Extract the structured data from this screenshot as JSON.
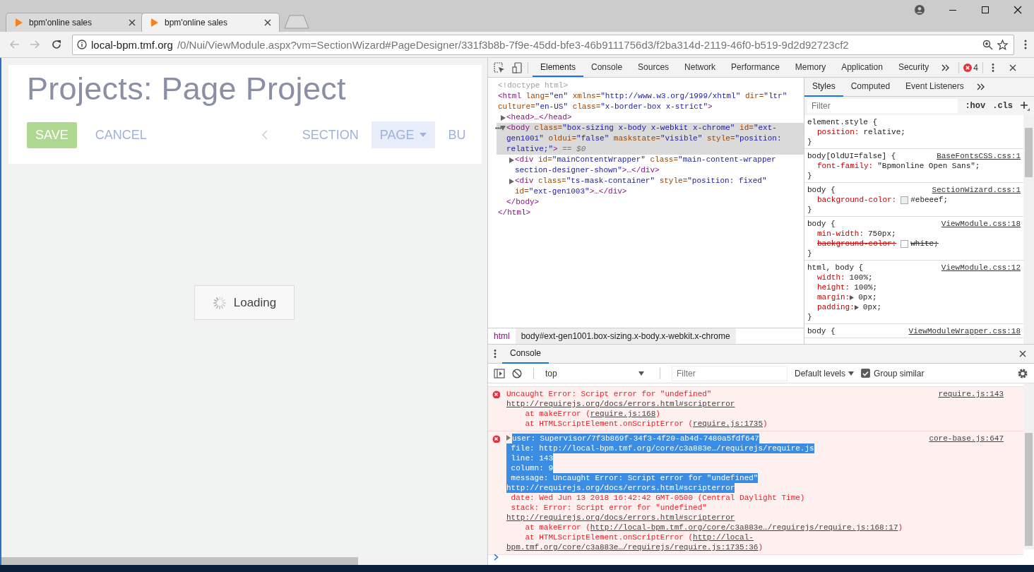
{
  "browser": {
    "tabs": [
      {
        "title": "bpm'online sales",
        "selected": false
      },
      {
        "title": "bpm'online sales",
        "selected": true
      }
    ],
    "address": {
      "host": "local-bpm.tmf.org",
      "path": "/0/Nui/ViewModule.aspx?vm=SectionWizard#PageDesigner/331f3b8b-7f9e-45dd-bfe3-46b9111756d3/f2ba314d-2119-46f0-b519-9d2d92723cf2"
    }
  },
  "page": {
    "title": "Projects: Page Project",
    "actions": [
      {
        "label": "SAVE",
        "kind": "primary"
      },
      {
        "label": "CANCEL",
        "kind": "link"
      }
    ],
    "nav": [
      {
        "label": "SECTION",
        "selected": false,
        "dropdown": false
      },
      {
        "label": "PAGE",
        "selected": true,
        "dropdown": true
      },
      {
        "label": "BU",
        "selected": false,
        "dropdown": false
      }
    ],
    "loading": "Loading"
  },
  "devtools": {
    "tabs": [
      {
        "label": "Elements",
        "selected": true
      },
      {
        "label": "Console",
        "selected": false
      },
      {
        "label": "Sources",
        "selected": false
      },
      {
        "label": "Network",
        "selected": false
      },
      {
        "label": "Performance",
        "selected": false
      },
      {
        "label": "Memory",
        "selected": false
      },
      {
        "label": "Application",
        "selected": false
      },
      {
        "label": "Security",
        "selected": false
      }
    ],
    "error_count": "4",
    "elements": {
      "nodes": [
        {
          "tokens": [
            {
              "kind": "doctype",
              "t": "<!doctype html>"
            }
          ]
        },
        {
          "tokens": [
            {
              "kind": "tag",
              "t": "<html"
            },
            {
              "kind": "attr",
              "t": " lang="
            },
            {
              "kind": "value",
              "t": "\"en\""
            },
            {
              "kind": "attr",
              "t": " xmlns="
            },
            {
              "kind": "value",
              "t": "\"http://www.w3.org/1999/xhtml\""
            },
            {
              "kind": "attr",
              "t": " dir="
            },
            {
              "kind": "value",
              "t": "\"ltr\""
            },
            {
              "kind": "attr",
              "t": " culture="
            },
            {
              "kind": "value",
              "t": "\"en-US\""
            },
            {
              "kind": "attr",
              "t": " class="
            },
            {
              "kind": "value",
              "t": "\"x-border-box x-strict\""
            },
            {
              "kind": "tag",
              "t": ">"
            }
          ],
          "close": "</html>",
          "children": [
            {
              "tokens": [
                {
                  "kind": "tag",
                  "t": "<head>…</head>"
                }
              ],
              "expanded": false
            },
            {
              "tokens": [
                {
                  "kind": "tag",
                  "t": "<body"
                },
                {
                  "kind": "attr",
                  "t": " class="
                },
                {
                  "kind": "value",
                  "t": "\"box-sizing x-body x-webkit x-chrome\""
                },
                {
                  "kind": "attr",
                  "t": " id="
                },
                {
                  "kind": "value",
                  "t": "\"ext-gen1001\""
                },
                {
                  "kind": "attr",
                  "t": " oldui="
                },
                {
                  "kind": "value",
                  "t": "\"false\""
                },
                {
                  "kind": "attr",
                  "t": " maskstate="
                },
                {
                  "kind": "value",
                  "t": "\"visible\""
                },
                {
                  "kind": "attr",
                  "t": " style="
                },
                {
                  "kind": "value",
                  "t": "\"position: relative;\""
                },
                {
                  "kind": "tag",
                  "t": ">"
                },
                {
                  "kind": "hint",
                  "t": " == $0"
                }
              ],
              "expanded": true,
              "selected": true,
              "close": "</body>",
              "children": [
                {
                  "tokens": [
                    {
                      "kind": "tag",
                      "t": "<div"
                    },
                    {
                      "kind": "attr",
                      "t": " id="
                    },
                    {
                      "kind": "value",
                      "t": "\"mainContentWrapper\""
                    },
                    {
                      "kind": "attr",
                      "t": " class="
                    },
                    {
                      "kind": "value",
                      "t": "\"main-content-wrapper section-designer-shown\""
                    },
                    {
                      "kind": "tag",
                      "t": ">…</div>"
                    }
                  ],
                  "expanded": false
                },
                {
                  "tokens": [
                    {
                      "kind": "tag",
                      "t": "<div"
                    },
                    {
                      "kind": "attr",
                      "t": " class="
                    },
                    {
                      "kind": "value",
                      "t": "\"ts-mask-container\""
                    },
                    {
                      "kind": "attr",
                      "t": " style="
                    },
                    {
                      "kind": "value",
                      "t": "\"position: fixed\""
                    },
                    {
                      "kind": "attr",
                      "t": " id="
                    },
                    {
                      "kind": "value",
                      "t": "\"ext-gen1003\""
                    },
                    {
                      "kind": "tag",
                      "t": ">…</div>"
                    }
                  ],
                  "expanded": false
                }
              ]
            }
          ]
        }
      ],
      "breadcrumbs": [
        {
          "label": "html",
          "selected": false
        },
        {
          "label": "body#ext-gen1001.box-sizing.x-body.x-webkit.x-chrome",
          "selected": true
        }
      ]
    },
    "styles": {
      "tabs": [
        {
          "label": "Styles",
          "selected": true
        },
        {
          "label": "Computed",
          "selected": false
        },
        {
          "label": "Event Listeners",
          "selected": false
        }
      ],
      "filter_placeholder": "Filter",
      "hov": ":hov",
      "cls": ".cls",
      "rules": [
        {
          "selector": "element.style {",
          "close": "}",
          "properties": [
            {
              "name": "position:",
              "value": "relative;"
            }
          ]
        },
        {
          "selector": "body[OldUI=false] {",
          "source": "BaseFontsCSS.css:1",
          "close": "}",
          "properties": [
            {
              "name": "font-family:",
              "value": "\"Bpmonline Open Sans\";"
            }
          ]
        },
        {
          "selector": "body {",
          "source": "SectionWizard.css:1",
          "close": "}",
          "properties": [
            {
              "name": "background-color:",
              "value": "#ebeeef;",
              "color": "#ebeeef"
            }
          ]
        },
        {
          "selector": "body {",
          "source": "ViewModule.css:18",
          "close": "}",
          "properties": [
            {
              "name": "min-width:",
              "value": "750px;"
            },
            {
              "name": "background-color:",
              "value": "white;",
              "color": "#ffffff",
              "struck": true
            }
          ]
        },
        {
          "selector": "html, body {",
          "source": "ViewModule.css:12",
          "close": "}",
          "properties": [
            {
              "name": "width:",
              "value": "100%;"
            },
            {
              "name": "height:",
              "value": "100%;"
            },
            {
              "name": "margin:",
              "value": "0px;",
              "expandable": true
            },
            {
              "name": "padding:",
              "value": "0px;",
              "expandable": true
            }
          ]
        },
        {
          "selector": "body {",
          "source": "ViewModuleWrapper.css:18"
        }
      ]
    },
    "console": {
      "tabs": [
        {
          "label": "Console",
          "selected": true
        }
      ],
      "context": "top",
      "filter_placeholder": "Filter",
      "levels": "Default levels",
      "group_similar": {
        "label": "Group similar",
        "checked": true
      },
      "messages": [
        {
          "kind": "error",
          "source": "require.js:143",
          "expandable": false,
          "lines": [
            {
              "selected": false,
              "parts": [
                {
                  "t": "Uncaught Error: Script error for \"undefined\""
                }
              ]
            },
            {
              "selected": false,
              "parts": [
                {
                  "t": "http://requirejs.org/docs/errors.html#scripterror",
                  "link": true
                }
              ]
            },
            {
              "selected": false,
              "parts": [
                {
                  "t": "    at makeError ("
                },
                {
                  "t": "require.js:168",
                  "link": true
                },
                {
                  "t": ")"
                }
              ]
            },
            {
              "selected": false,
              "parts": [
                {
                  "t": "    at HTMLScriptElement.onScriptError ("
                },
                {
                  "t": "require.js:1735",
                  "link": true
                },
                {
                  "t": ")"
                }
              ]
            }
          ]
        },
        {
          "kind": "error",
          "source": "core-base.js:647",
          "expandable": true,
          "lines": [
            {
              "selected": true,
              "parts": [
                {
                  "t": "user: Supervisor/7f3b869f-34f3-4f20-ab4d-7480a5fdf647"
                }
              ]
            },
            {
              "selected": true,
              "parts": [
                {
                  "t": " file: http://local-bpm.tmf.org/core/c3a883e…/requirejs/require.js"
                }
              ]
            },
            {
              "selected": true,
              "parts": [
                {
                  "t": " line: 143"
                }
              ]
            },
            {
              "selected": true,
              "parts": [
                {
                  "t": " column: 9"
                }
              ]
            },
            {
              "selected": true,
              "parts": [
                {
                  "t": " message: Uncaught Error: Script error for \"undefined\""
                }
              ]
            },
            {
              "selected": true,
              "parts": [
                {
                  "t": "http://requirejs.org/docs/errors.html#scripterror"
                }
              ]
            },
            {
              "selected": false,
              "parts": [
                {
                  "t": " date: Wed Jun 13 2018 16:42:42 GMT-0500 (Central Daylight Time)"
                }
              ]
            },
            {
              "selected": false,
              "parts": [
                {
                  "t": " stack: Error: Script error for \"undefined\""
                }
              ]
            },
            {
              "selected": false,
              "parts": [
                {
                  "t": "http://requirejs.org/docs/errors.html#scripterror",
                  "link": true
                }
              ]
            },
            {
              "selected": false,
              "parts": [
                {
                  "t": "    at makeError ("
                },
                {
                  "t": "http://local-bpm.tmf.org/core/c3a883e…/requirejs/require.js:168:17",
                  "link": true
                },
                {
                  "t": ")"
                }
              ]
            },
            {
              "selected": false,
              "parts": [
                {
                  "t": "    at HTMLScriptElement.onScriptError ("
                },
                {
                  "t": "http://local-",
                  "link": true
                }
              ]
            },
            {
              "selected": false,
              "parts": [
                {
                  "t": "bpm.tmf.org/core/c3a883e…/requirejs/require.js:1735:36",
                  "link": true
                },
                {
                  "t": ")"
                }
              ]
            }
          ]
        }
      ]
    }
  }
}
